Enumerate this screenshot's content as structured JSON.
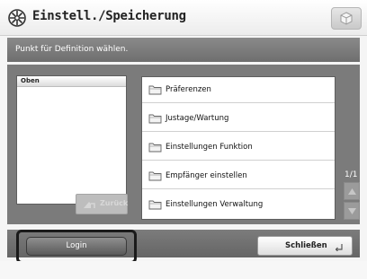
{
  "window": {
    "title": "Einstell./Speicherung",
    "icon": "settings-star-icon"
  },
  "instruction": "Punkt für Definition wählen.",
  "left_panel": {
    "header": "Oben",
    "up_button": "Zurück"
  },
  "list": {
    "items": [
      {
        "label": "Präferenzen",
        "icon": "folder-icon"
      },
      {
        "label": "Justage/Wartung",
        "icon": "folder-icon"
      },
      {
        "label": "Einstellungen Funktion",
        "icon": "folder-icon"
      },
      {
        "label": "Empfänger einstellen",
        "icon": "folder-icon"
      },
      {
        "label": "Einstellungen Verwaltung",
        "icon": "folder-icon"
      }
    ],
    "page_indicator": "1/1"
  },
  "buttons": {
    "login": "Login",
    "close": "Schließen"
  },
  "colors": {
    "content_bg": "#7b7b7b",
    "instruction_bg": "#7a7a7a",
    "login_highlight": "#1a1a1a"
  }
}
